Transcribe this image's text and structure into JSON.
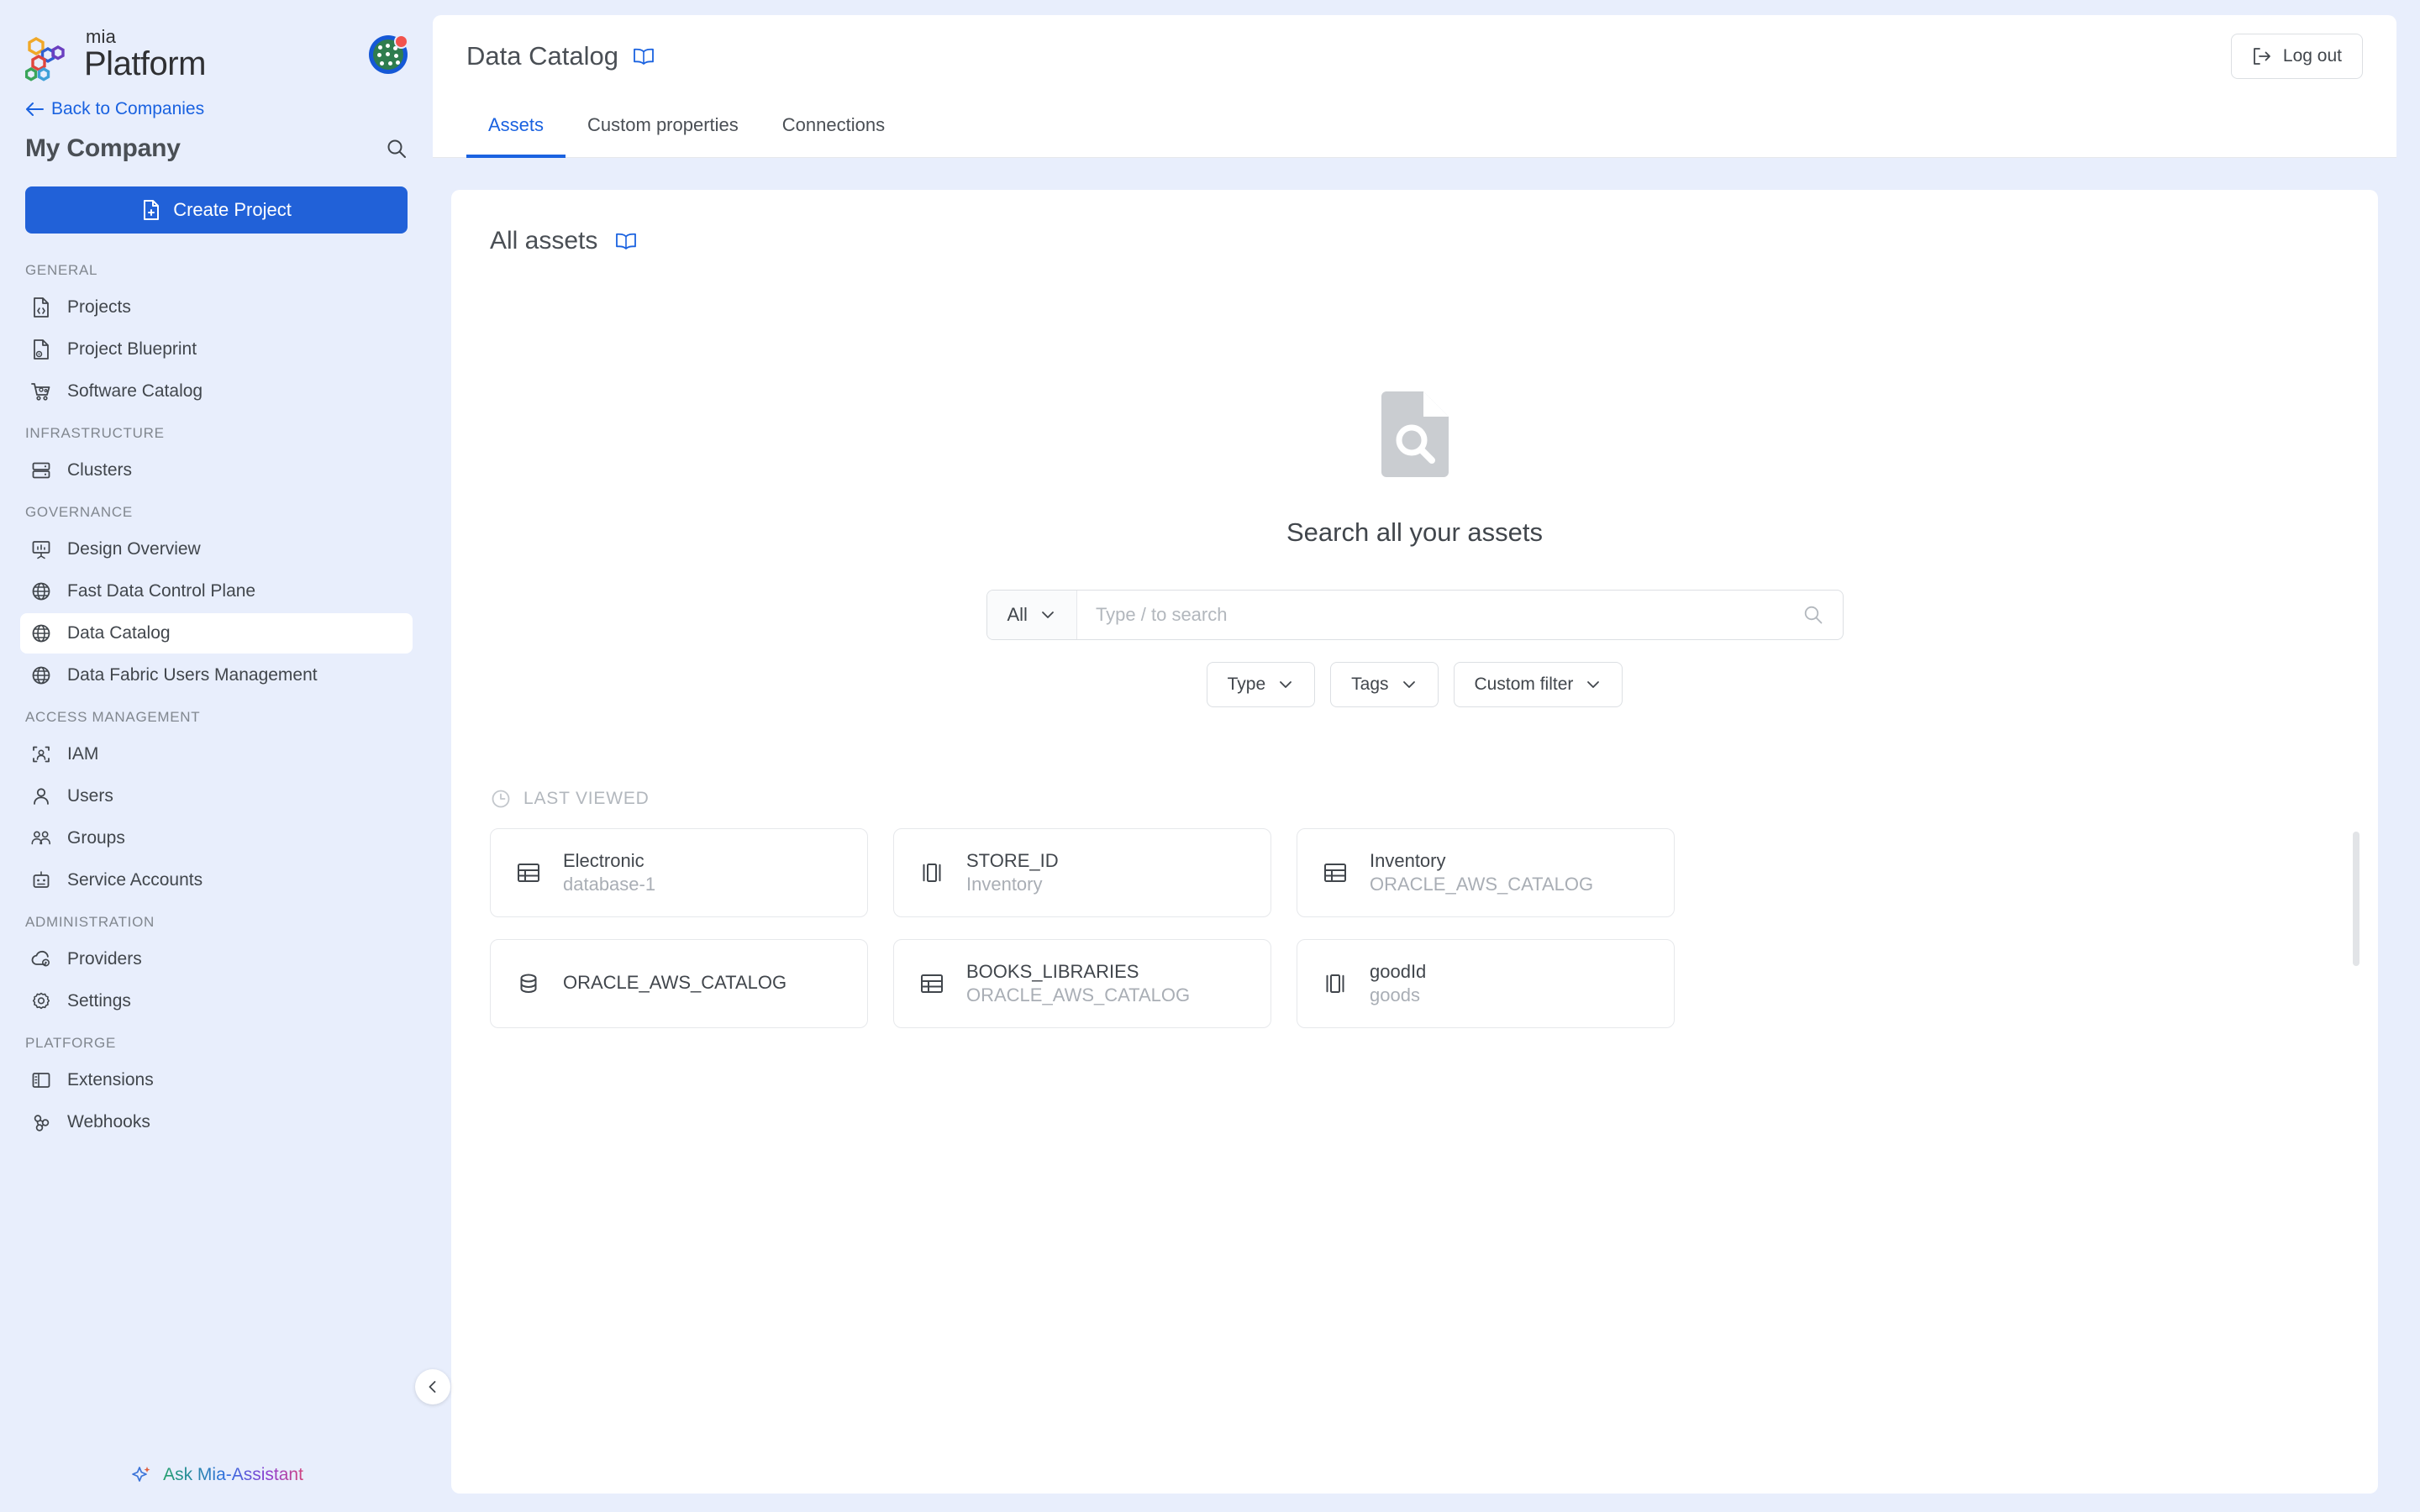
{
  "sidebar": {
    "brand": {
      "mia": "mia",
      "platform": "Platform"
    },
    "avatar_name": "user-avatar",
    "back_link": "Back to Companies",
    "company_name": "My Company",
    "create_button": "Create Project",
    "groups": [
      {
        "label": "GENERAL",
        "items": [
          {
            "label": "Projects",
            "icon": "file-code-icon",
            "active": false
          },
          {
            "label": "Project Blueprint",
            "icon": "file-gear-icon",
            "active": false
          },
          {
            "label": "Software Catalog",
            "icon": "shopping-cart-icon",
            "active": false
          }
        ]
      },
      {
        "label": "INFRASTRUCTURE",
        "items": [
          {
            "label": "Clusters",
            "icon": "server-icon",
            "active": false
          }
        ]
      },
      {
        "label": "GOVERNANCE",
        "items": [
          {
            "label": "Design Overview",
            "icon": "presentation-chart-icon",
            "active": false
          },
          {
            "label": "Fast Data Control Plane",
            "icon": "globe-icon",
            "active": false
          },
          {
            "label": "Data Catalog",
            "icon": "globe-icon",
            "active": true
          },
          {
            "label": "Data Fabric Users Management",
            "icon": "globe-icon",
            "active": false
          }
        ]
      },
      {
        "label": "ACCESS MANAGEMENT",
        "items": [
          {
            "label": "IAM",
            "icon": "user-scan-icon",
            "active": false
          },
          {
            "label": "Users",
            "icon": "user-icon",
            "active": false
          },
          {
            "label": "Groups",
            "icon": "users-group-icon",
            "active": false
          },
          {
            "label": "Service Accounts",
            "icon": "robot-icon",
            "active": false
          }
        ]
      },
      {
        "label": "ADMINISTRATION",
        "items": [
          {
            "label": "Providers",
            "icon": "cloud-gear-icon",
            "active": false
          },
          {
            "label": "Settings",
            "icon": "gear-icon",
            "active": false
          }
        ]
      },
      {
        "label": "PLATFORGE",
        "items": [
          {
            "label": "Extensions",
            "icon": "panel-layout-icon",
            "active": false
          },
          {
            "label": "Webhooks",
            "icon": "webhook-icon",
            "active": false
          }
        ]
      }
    ],
    "assistant_label": "Ask Mia-Assistant",
    "collapse_label": "chevron-left-icon"
  },
  "header": {
    "page_title": "Data Catalog",
    "doc_icon": "book-icon",
    "logout_label": "Log out",
    "tabs": [
      {
        "label": "Assets",
        "active": true
      },
      {
        "label": "Custom properties",
        "active": false
      },
      {
        "label": "Connections",
        "active": false
      }
    ]
  },
  "main": {
    "section_title": "All assets",
    "section_doc_icon": "book-icon",
    "empty_state": {
      "icon": "document-search-icon",
      "title": "Search all your assets"
    },
    "search": {
      "scope_value": "All",
      "placeholder": "Type / to search",
      "value": "",
      "submit_icon": "search-icon"
    },
    "filters": [
      {
        "label": "Type"
      },
      {
        "label": "Tags"
      },
      {
        "label": "Custom filter"
      }
    ],
    "last_viewed": {
      "icon": "clock-icon",
      "label": "LAST VIEWED",
      "cards": [
        {
          "name": "Electronic",
          "sub": "database-1",
          "icon": "table-icon"
        },
        {
          "name": "STORE_ID",
          "sub": "Inventory",
          "icon": "column-icon"
        },
        {
          "name": "Inventory",
          "sub": "ORACLE_AWS_CATALOG",
          "icon": "table-icon"
        },
        {
          "name": "ORACLE_AWS_CATALOG",
          "sub": "",
          "icon": "database-icon"
        },
        {
          "name": "BOOKS_LIBRARIES",
          "sub": "ORACLE_AWS_CATALOG",
          "icon": "table-icon"
        },
        {
          "name": "goodId",
          "sub": "goods",
          "icon": "column-icon"
        }
      ]
    }
  },
  "colors": {
    "accent_blue": "#1a62e0",
    "button_blue": "#2161d8",
    "sidebar_bg": "#e8eefc",
    "text_primary": "#41464c",
    "text_muted": "#a9aeb5"
  }
}
